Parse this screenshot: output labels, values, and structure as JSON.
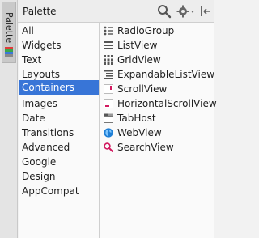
{
  "strip": {
    "tab_label": "Palette"
  },
  "header": {
    "title": "Palette"
  },
  "categories": [
    {
      "label": "All"
    },
    {
      "label": "Widgets"
    },
    {
      "label": "Text"
    },
    {
      "label": "Layouts"
    },
    {
      "label": "Containers",
      "selected": true
    },
    {
      "label": "Images"
    },
    {
      "label": "Date"
    },
    {
      "label": "Transitions"
    },
    {
      "label": "Advanced"
    },
    {
      "label": "Google"
    },
    {
      "label": "Design"
    },
    {
      "label": "AppCompat"
    }
  ],
  "items": [
    {
      "label": "RadioGroup",
      "icon": "radio-group-icon"
    },
    {
      "label": "ListView",
      "icon": "list-view-icon"
    },
    {
      "label": "GridView",
      "icon": "grid-view-icon"
    },
    {
      "label": "ExpandableListView",
      "icon": "expandable-list-icon"
    },
    {
      "label": "ScrollView",
      "icon": "scroll-view-icon"
    },
    {
      "label": "HorizontalScrollView",
      "icon": "horizontal-scroll-icon"
    },
    {
      "label": "TabHost",
      "icon": "tab-host-icon"
    },
    {
      "label": "WebView",
      "icon": "web-view-icon"
    },
    {
      "label": "SearchView",
      "icon": "search-view-icon"
    }
  ],
  "colors": {
    "selection": "#3875d7",
    "accent_pink": "#d2195f",
    "web_blue": "#1f7fd6"
  }
}
